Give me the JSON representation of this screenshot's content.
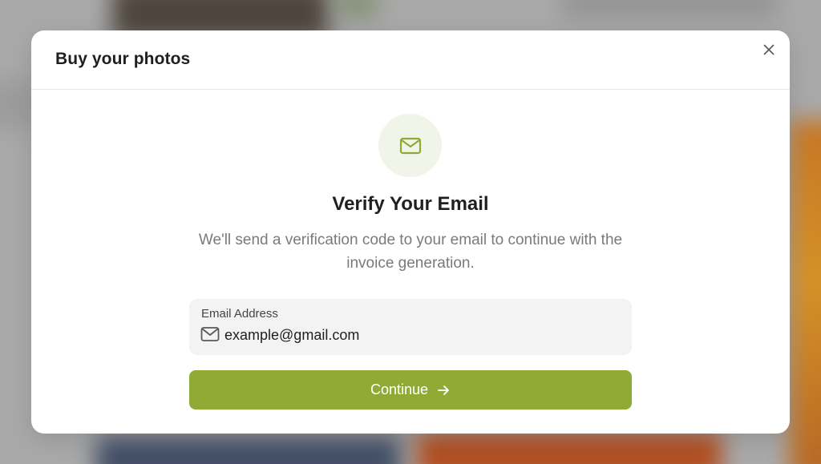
{
  "modal": {
    "title": "Buy your photos",
    "close_icon": "close-icon"
  },
  "verify": {
    "icon": "mail-icon",
    "heading": "Verify Your Email",
    "description": "We'll send a verification code to your email to continue with the invoice generation."
  },
  "email_field": {
    "label": "Email Address",
    "icon": "mail-icon",
    "placeholder": "example@gmail.com",
    "value": ""
  },
  "continue_button": {
    "label": "Continue",
    "icon": "arrow-right-icon"
  },
  "colors": {
    "accent": "#8fab35",
    "icon_circle_bg": "#f1f4e8",
    "field_bg": "#f3f3f3"
  }
}
